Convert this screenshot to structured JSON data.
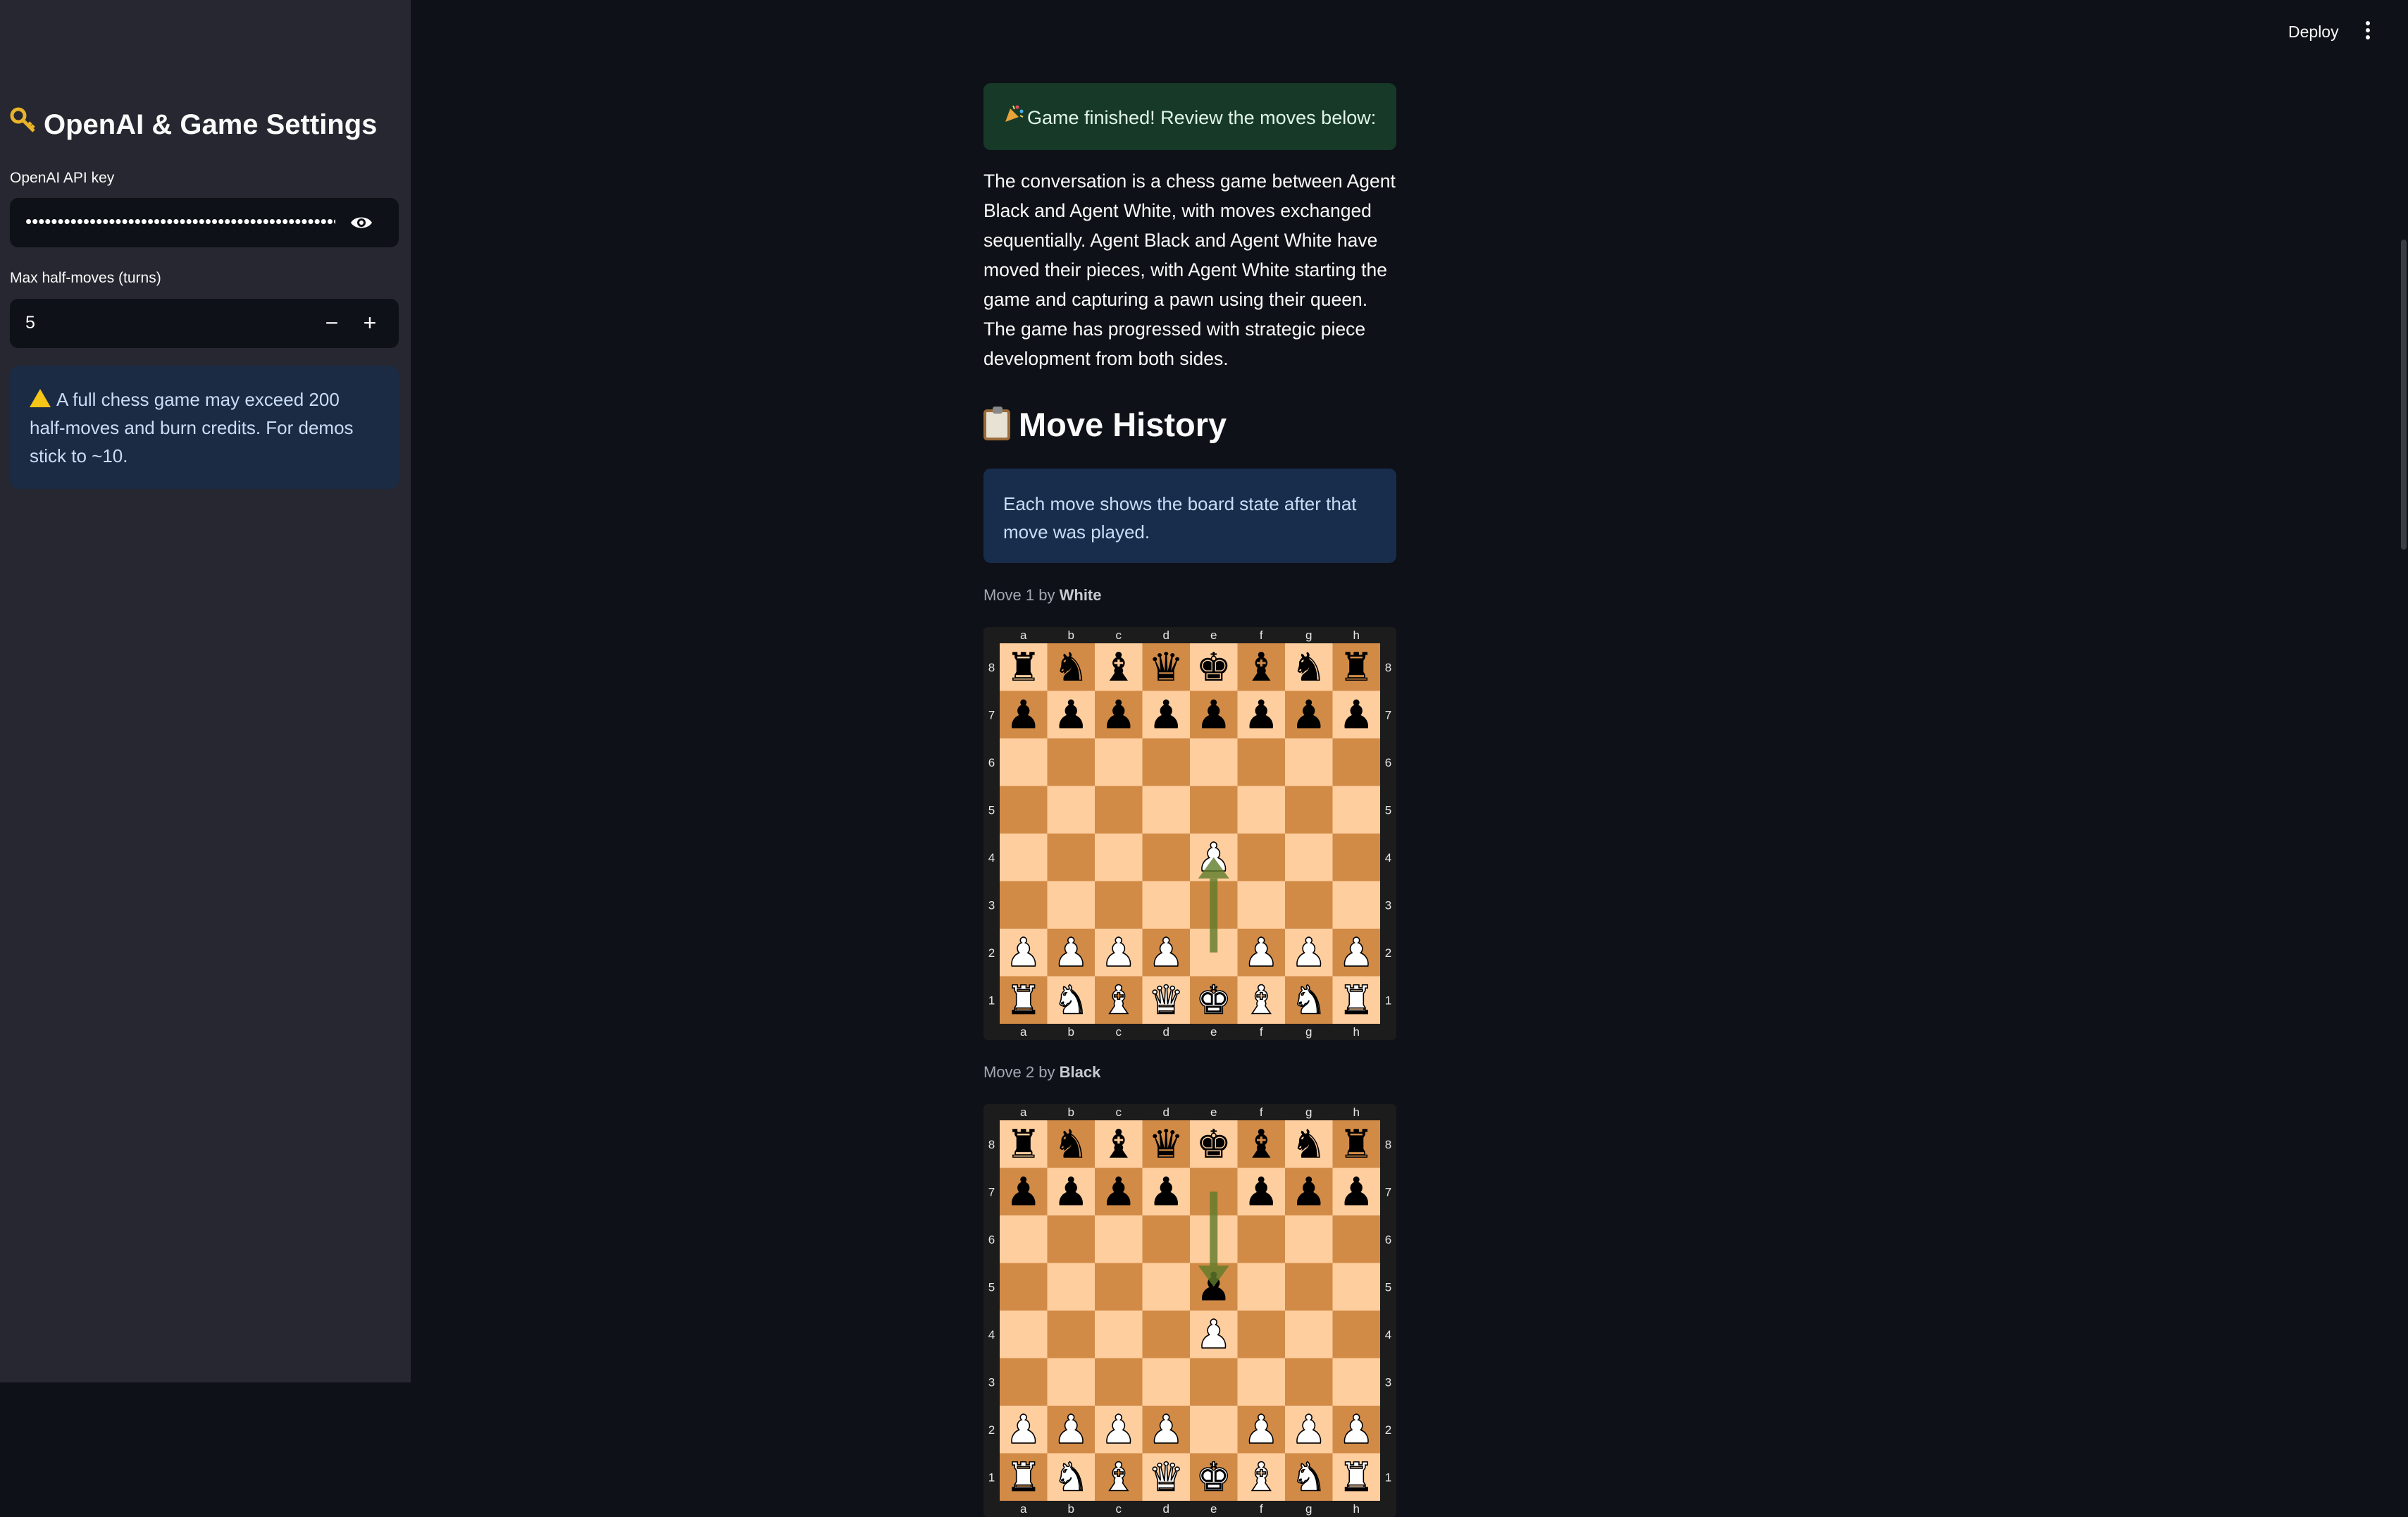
{
  "header": {
    "deploy_label": "Deploy",
    "menu_icon": "kebab-menu-icon"
  },
  "sidebar": {
    "title": "OpenAI & Game Settings",
    "title_icon": "key-icon",
    "api_key_label": "OpenAI API key",
    "api_key_value": "••••••••••••••••••••••••••••••••••••••••••••••••••••",
    "max_moves_label": "Max half-moves (turns)",
    "max_moves_value": "5",
    "decrement_label": "−",
    "increment_label": "+",
    "warning_text": "A full chess game may exceed 200 half-moves and burn credits. For demos stick to ~10."
  },
  "main": {
    "success_text": "Game finished! Review the moves below:",
    "summary": "The conversation is a chess game between Agent Black and Agent White, with moves exchanged sequentially. Agent Black and Agent White have moved their pieces, with Agent White starting the game and capturing a pawn using their queen. The game has progressed with strategic piece development from both sides.",
    "section_title": "Move History",
    "info_text": "Each move shows the board state after that move was played."
  },
  "board_labels": {
    "files": [
      "a",
      "b",
      "c",
      "d",
      "e",
      "f",
      "g",
      "h"
    ],
    "ranks": [
      "8",
      "7",
      "6",
      "5",
      "4",
      "3",
      "2",
      "1"
    ]
  },
  "moves": [
    {
      "caption_prefix": "Move 1 by ",
      "player": "White",
      "board": [
        "rnbqkbnr",
        "pppppppp",
        "........",
        "........",
        "....P...",
        "........",
        "PPPP.PPP",
        "RNBQKBNR"
      ],
      "arrow": {
        "from": "e2",
        "to": "e4"
      }
    },
    {
      "caption_prefix": "Move 2 by ",
      "player": "Black",
      "board": [
        "rnbqkbnr",
        "pppp.ppp",
        "........",
        "....p...",
        "....P...",
        "........",
        "PPPP.PPP",
        "RNBQKBNR"
      ],
      "arrow": {
        "from": "e7",
        "to": "e5"
      }
    }
  ],
  "colors": {
    "light_square": "#ffce9e",
    "dark_square": "#d18b47",
    "arrow": "#5f7c2a",
    "board_frame": "#1c1c1c"
  }
}
